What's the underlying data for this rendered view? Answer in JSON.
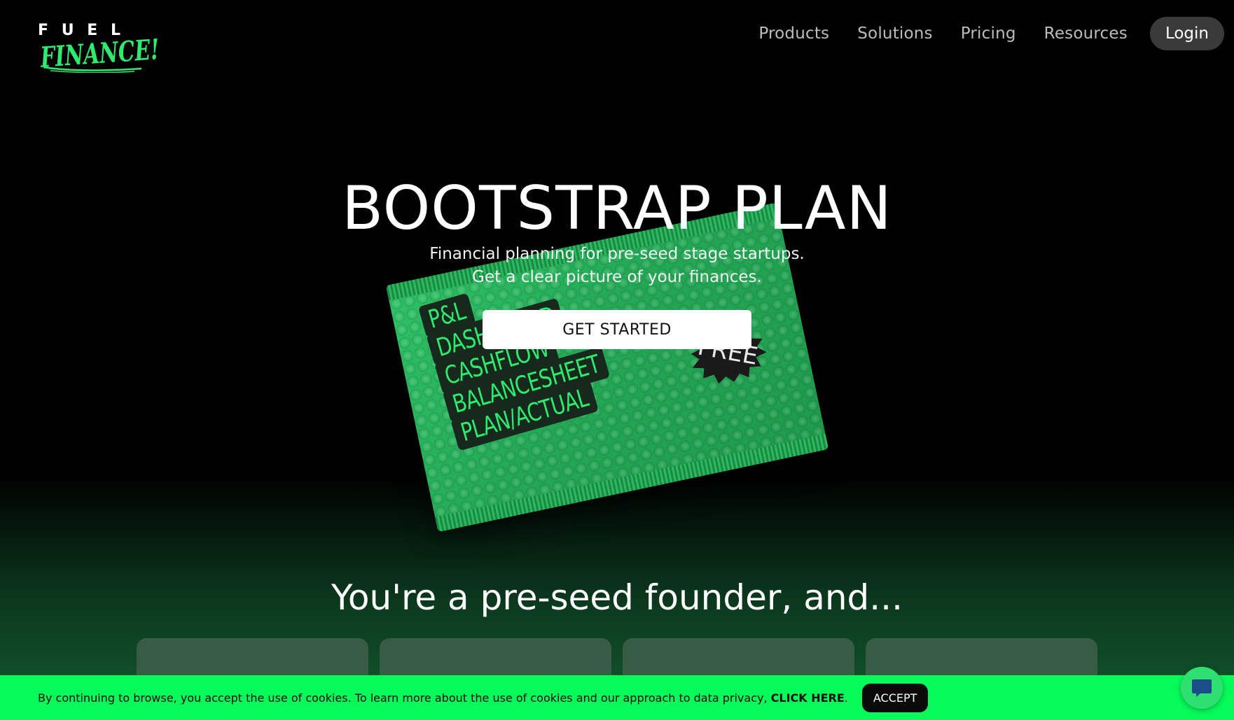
{
  "brand": {
    "logo_top": "FUEL",
    "logo_script": "FINANCE!",
    "accent": "#2eea6e"
  },
  "nav": {
    "items": [
      "Products",
      "Solutions",
      "Pricing",
      "Resources"
    ],
    "login_label": "Login"
  },
  "hero": {
    "title": "BOOTSTRAP PLAN",
    "subtitle_line1": "Financial planning for pre-seed stage startups.",
    "subtitle_line2": "Get a clear picture of your finances.",
    "cta_label": "GET STARTED",
    "packet_features": [
      "P&L",
      "DASHBOARD",
      "CASHFLOW",
      "BALANCESHEET",
      "PLAN/ACTUAL"
    ],
    "packet_badge": "FREE"
  },
  "section": {
    "title": "You're a pre-seed founder, and..."
  },
  "cookie": {
    "text": "By continuing to browse, you accept the use of cookies. To learn more about the use of cookies and our approach to data privacy, ",
    "link_label": "CLICK HERE",
    "period": ".",
    "accept_label": "ACCEPT",
    "bar_color": "#06fb5a"
  },
  "chat": {
    "icon": "chat-bubble-icon"
  }
}
